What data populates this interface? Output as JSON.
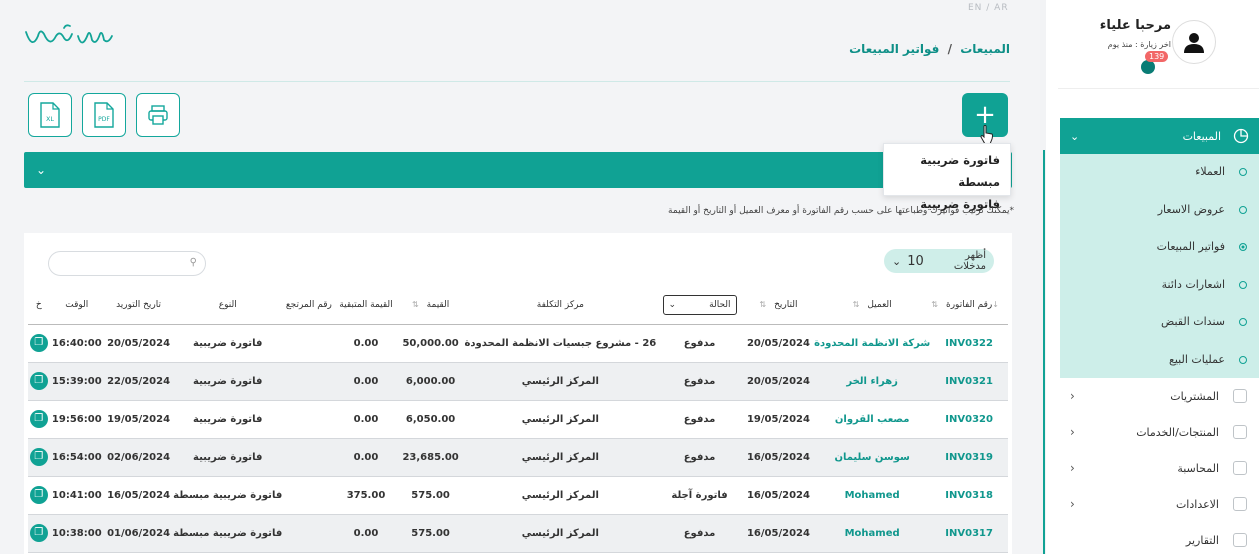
{
  "header": {
    "lang_switch": "EN / AR",
    "breadcrumb": {
      "root": "المبيعات",
      "sep": "/",
      "current": "فواتير المبيعات"
    }
  },
  "toolbar": {
    "excel_label": "XL",
    "pdf_label": "PDF",
    "add_label": "+"
  },
  "add_menu": {
    "items": [
      "فاتورة ضريبية مبسطة",
      "فاتورة ضريبية"
    ]
  },
  "hint": "*يمكنك ترتيب فواتيرك وطباعتها على حسب رقم الفاتورة أو معرف العميل أو التاريخ أو القيمة",
  "pager": {
    "label": "أظهر مدخلات",
    "value": "10"
  },
  "table": {
    "headers": {
      "invoice_no": "رقم الفاتورة",
      "customer": "العميل",
      "date": "التاريخ",
      "status": "الحالة",
      "cost_center": "مركز التكلفة",
      "amount": "القيمة",
      "remaining": "القيمة المتبقية",
      "ref_no": "رقم المرتجع",
      "type": "النوع",
      "supply_date": "تاريخ التوريد",
      "time": "الوقت",
      "extra": "خ"
    },
    "rows": [
      {
        "invoice_no": "INV0322",
        "customer": "شركة الانظمة المحدودة",
        "date": "20/05/2024",
        "status": "مدفوع",
        "cost_center": "26 - مشروع جبسيات الانظمة المحدودة",
        "amount": "50,000.00",
        "remaining": "0.00",
        "ref_no": "",
        "type": "فاتورة ضريبية",
        "supply_date": "20/05/2024",
        "time": "16:40:00"
      },
      {
        "invoice_no": "INV0321",
        "customer": "زهراء الخر",
        "date": "20/05/2024",
        "status": "مدفوع",
        "cost_center": "المركز الرئيسي",
        "amount": "6,000.00",
        "remaining": "0.00",
        "ref_no": "",
        "type": "فاتورة ضريبية",
        "supply_date": "22/05/2024",
        "time": "15:39:00"
      },
      {
        "invoice_no": "INV0320",
        "customer": "مصعب القروان",
        "date": "19/05/2024",
        "status": "مدفوع",
        "cost_center": "المركز الرئيسي",
        "amount": "6,050.00",
        "remaining": "0.00",
        "ref_no": "",
        "type": "فاتورة ضريبية",
        "supply_date": "19/05/2024",
        "time": "19:56:00"
      },
      {
        "invoice_no": "INV0319",
        "customer": "سوسن سليمان",
        "date": "16/05/2024",
        "status": "مدفوع",
        "cost_center": "المركز الرئيسي",
        "amount": "23,685.00",
        "remaining": "0.00",
        "ref_no": "",
        "type": "فاتورة ضريبية",
        "supply_date": "02/06/2024",
        "time": "16:54:00"
      },
      {
        "invoice_no": "INV0318",
        "customer": "Mohamed",
        "date": "16/05/2024",
        "status": "فاتورة آجلة",
        "cost_center": "المركز الرئيسي",
        "amount": "575.00",
        "remaining": "375.00",
        "ref_no": "",
        "type": "فاتورة ضريبية مبسطة",
        "supply_date": "16/05/2024",
        "time": "10:41:00"
      },
      {
        "invoice_no": "INV0317",
        "customer": "Mohamed",
        "date": "16/05/2024",
        "status": "مدفوع",
        "cost_center": "المركز الرئيسي",
        "amount": "575.00",
        "remaining": "0.00",
        "ref_no": "",
        "type": "فاتورة ضريبية مبسطة",
        "supply_date": "01/06/2024",
        "time": "10:38:00"
      }
    ]
  },
  "user": {
    "greeting": "مرحبا علياء",
    "last_visit": "اخر زيارة : منذ يوم",
    "notifications": "139"
  },
  "sidebar": {
    "sales": "المبيعات",
    "sub_items": [
      "العملاء",
      "عروض الاسعار",
      "فواتير المبيعات",
      "اشعارات دائنة",
      "سندات القبض",
      "عمليات البيع"
    ],
    "items": [
      "المشتريات",
      "المنتجات/الخدمات",
      "المحاسبة",
      "الاعدادات",
      "التقارير"
    ]
  },
  "colors": {
    "accent": "#10a294",
    "submenu_bg": "#cdeee9",
    "badge": "#f26767"
  }
}
